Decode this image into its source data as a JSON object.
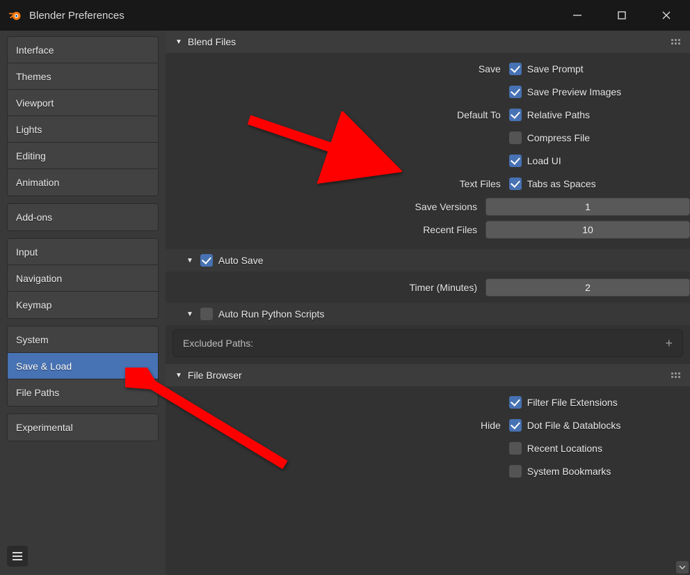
{
  "window": {
    "title": "Blender Preferences"
  },
  "sidebar": {
    "groups": [
      {
        "tabs": [
          "Interface",
          "Themes",
          "Viewport",
          "Lights",
          "Editing",
          "Animation"
        ]
      },
      {
        "tabs": [
          "Add-ons"
        ]
      },
      {
        "tabs": [
          "Input",
          "Navigation",
          "Keymap"
        ]
      },
      {
        "tabs": [
          "System",
          "Save & Load",
          "File Paths"
        ]
      },
      {
        "tabs": [
          "Experimental"
        ]
      }
    ],
    "active": "Save & Load"
  },
  "sections": {
    "blend_files": {
      "title": "Blend Files",
      "save_label": "Save",
      "save_prompt": {
        "label": "Save Prompt",
        "checked": true
      },
      "save_preview": {
        "label": "Save Preview Images",
        "checked": true
      },
      "default_to_label": "Default To",
      "relative_paths": {
        "label": "Relative Paths",
        "checked": true
      },
      "compress_file": {
        "label": "Compress File",
        "checked": false
      },
      "load_ui": {
        "label": "Load UI",
        "checked": true
      },
      "text_files_label": "Text Files",
      "tabs_as_spaces": {
        "label": "Tabs as Spaces",
        "checked": true
      },
      "save_versions": {
        "label": "Save Versions",
        "value": "1"
      },
      "recent_files": {
        "label": "Recent Files",
        "value": "10"
      },
      "auto_save": {
        "label": "Auto Save",
        "checked": true
      },
      "timer": {
        "label": "Timer (Minutes)",
        "value": "2"
      },
      "auto_run": {
        "label": "Auto Run Python Scripts",
        "checked": false
      },
      "excluded_paths_label": "Excluded Paths:"
    },
    "file_browser": {
      "title": "File Browser",
      "filter_ext": {
        "label": "Filter File Extensions",
        "checked": true
      },
      "hide_label": "Hide",
      "dot_files": {
        "label": "Dot File & Datablocks",
        "checked": true
      },
      "recent_locations": {
        "label": "Recent Locations",
        "checked": false
      },
      "system_bookmarks": {
        "label": "System Bookmarks",
        "checked": false
      }
    }
  }
}
